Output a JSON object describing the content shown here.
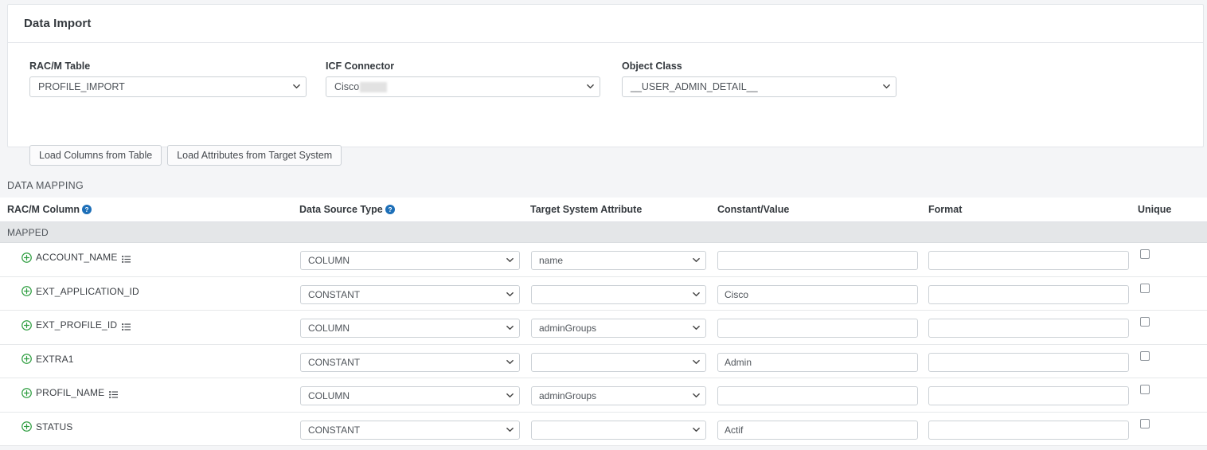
{
  "card": {
    "title": "Data Import",
    "fields": [
      {
        "label": "RAC/M Table",
        "value": "PROFILE_IMPORT",
        "redacted": false
      },
      {
        "label": "ICF Connector",
        "value": "Cisco",
        "redacted": true
      },
      {
        "label": "Object Class",
        "value": "__USER_ADMIN_DETAIL__",
        "redacted": false
      }
    ],
    "buttons": [
      {
        "label": "Load Columns from Table"
      },
      {
        "label": "Load Attributes from Target System"
      }
    ]
  },
  "data_mapping": {
    "section_title": "DATA MAPPING",
    "columns": [
      {
        "label": "RAC/M Column",
        "help": true
      },
      {
        "label": "Data Source Type",
        "help": true
      },
      {
        "label": "Target System Attribute",
        "help": false
      },
      {
        "label": "Constant/Value",
        "help": false
      },
      {
        "label": "Format",
        "help": false
      },
      {
        "label": "Unique",
        "help": false
      }
    ],
    "group_label": "MAPPED",
    "rows": [
      {
        "name": "ACCOUNT_NAME",
        "has_list_icon": true,
        "data_source_type": "COLUMN",
        "target_system_attribute": "name",
        "constant_value": "",
        "format": "",
        "unique": false
      },
      {
        "name": "EXT_APPLICATION_ID",
        "has_list_icon": false,
        "data_source_type": "CONSTANT",
        "target_system_attribute": "",
        "constant_value": "Cisco",
        "format": "",
        "unique": false
      },
      {
        "name": "EXT_PROFILE_ID",
        "has_list_icon": true,
        "data_source_type": "COLUMN",
        "target_system_attribute": "adminGroups",
        "constant_value": "",
        "format": "",
        "unique": false
      },
      {
        "name": "EXTRA1",
        "has_list_icon": false,
        "data_source_type": "CONSTANT",
        "target_system_attribute": "",
        "constant_value": "Admin",
        "format": "",
        "unique": false
      },
      {
        "name": "PROFIL_NAME",
        "has_list_icon": true,
        "data_source_type": "COLUMN",
        "target_system_attribute": "adminGroups",
        "constant_value": "",
        "format": "",
        "unique": false
      },
      {
        "name": "STATUS",
        "has_list_icon": false,
        "data_source_type": "CONSTANT",
        "target_system_attribute": "",
        "constant_value": "Actif",
        "format": "",
        "unique": false
      }
    ]
  },
  "colors": {
    "help_icon": "#1d6fb8",
    "add_icon": "#2f9e41",
    "group_band": "#e4e6e8"
  }
}
